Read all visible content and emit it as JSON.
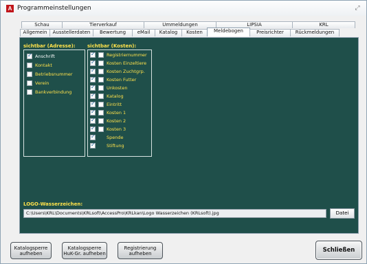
{
  "window": {
    "title": "Programmeinstellungen",
    "icon_letter": "A"
  },
  "tabs_row1": [
    "Schau",
    "Tierverkauf",
    "Ummeldungen",
    "LIPSIA",
    "KRL"
  ],
  "tabs_row2": [
    "Allgemein",
    "Ausstellerdaten",
    "Bewertung",
    "eMail",
    "Katalog",
    "Kosten",
    "Meldebogen",
    "Preisrichter",
    "Rückmeldungen"
  ],
  "active_tab": "Meldebogen",
  "address": {
    "heading": "sichtbar (Adresse):",
    "items": [
      {
        "label": "Anschrift",
        "checked": true
      },
      {
        "label": "Kontakt",
        "checked": false
      },
      {
        "label": "Betriebsnummer",
        "checked": false
      },
      {
        "label": "Verein",
        "checked": false
      },
      {
        "label": "Bankverbindung",
        "checked": false
      }
    ]
  },
  "costs": {
    "heading": "sichtbar (Kosten):",
    "items": [
      {
        "label": "Registriernummer",
        "checked": true,
        "second": false,
        "has_second": true
      },
      {
        "label": "Kosten Einzeltiere",
        "checked": true,
        "second": false,
        "has_second": true
      },
      {
        "label": "Kosten Zuchtgrp.",
        "checked": true,
        "second": false,
        "has_second": true
      },
      {
        "label": "Kosten Futter",
        "checked": true,
        "second": false,
        "has_second": true
      },
      {
        "label": "Unkosten",
        "checked": true,
        "second": false,
        "has_second": true
      },
      {
        "label": "Katalog",
        "checked": true,
        "second": false,
        "has_second": true
      },
      {
        "label": "Eintritt",
        "checked": true,
        "second": false,
        "has_second": true
      },
      {
        "label": "Kosten 1",
        "checked": true,
        "second": false,
        "has_second": true
      },
      {
        "label": "Kosten 2",
        "checked": true,
        "second": false,
        "has_second": true
      },
      {
        "label": "Kosten 3",
        "checked": true,
        "second": false,
        "has_second": true
      },
      {
        "label": "Spende",
        "checked": true,
        "second": false,
        "has_second": false
      },
      {
        "label": "Stiftung",
        "checked": true,
        "second": false,
        "has_second": false
      }
    ]
  },
  "logo": {
    "heading": "LOGO-Wasserzeichen:",
    "path": "C:\\Users\\KRL\\Documents\\KRLsoft\\AccessPro\\KRLkan\\Logo Wasserzeichen (KRLsoft).jpg",
    "button": "Datei"
  },
  "buttons": {
    "katalogsperre": [
      "Katalogsperre",
      "aufheben"
    ],
    "katalogsperre_hukgr": [
      "Katalogsperre",
      "HuK-Gr. aufheben"
    ],
    "registrierung": [
      "Registrierung",
      "aufheben"
    ],
    "schliessen": "Schließen"
  },
  "colors": {
    "panel": "#1f4f4a",
    "label_yellow": "#ffe24a"
  }
}
